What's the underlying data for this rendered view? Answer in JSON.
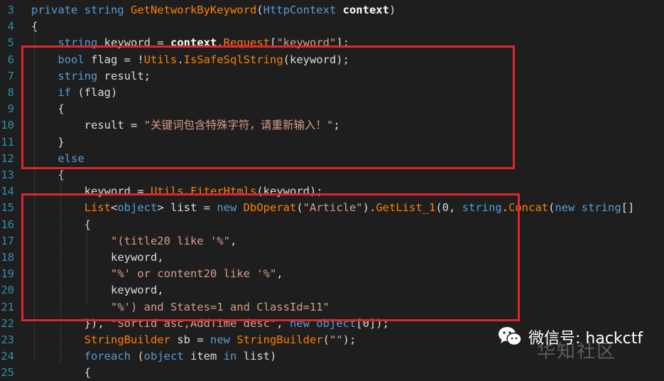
{
  "editor": {
    "lines": [
      {
        "n": "3",
        "tokens": [
          [
            "kw",
            "private string "
          ],
          [
            "m",
            "GetNetworkByKeyword"
          ],
          [
            "x",
            "("
          ],
          [
            "kw",
            "HttpContext "
          ],
          [
            "b",
            "context"
          ],
          [
            "x",
            ")"
          ]
        ]
      },
      {
        "n": "4",
        "tokens": [
          [
            "x",
            "{"
          ]
        ]
      },
      {
        "n": "5",
        "tokens": [
          [
            "x",
            "    "
          ],
          [
            "kw",
            "string "
          ],
          [
            "x",
            "keyword = "
          ],
          [
            "b",
            "context"
          ],
          [
            "x",
            "."
          ],
          [
            "m",
            "Request"
          ],
          [
            "x",
            "["
          ],
          [
            "s",
            "\"keyword\""
          ],
          [
            "x",
            "];"
          ]
        ]
      },
      {
        "n": "6",
        "tokens": [
          [
            "x",
            "    "
          ],
          [
            "kw",
            "bool "
          ],
          [
            "x",
            "flag = !"
          ],
          [
            "m",
            "Utils"
          ],
          [
            "x",
            "."
          ],
          [
            "m",
            "IsSafeSqlString"
          ],
          [
            "x",
            "(keyword);"
          ]
        ]
      },
      {
        "n": "7",
        "tokens": [
          [
            "x",
            "    "
          ],
          [
            "kw",
            "string "
          ],
          [
            "x",
            "result;"
          ]
        ]
      },
      {
        "n": "8",
        "tokens": [
          [
            "x",
            "    "
          ],
          [
            "kw",
            "if "
          ],
          [
            "x",
            "(flag)"
          ]
        ]
      },
      {
        "n": "9",
        "tokens": [
          [
            "x",
            "    {"
          ]
        ]
      },
      {
        "n": "10",
        "tokens": [
          [
            "x",
            "        result = "
          ],
          [
            "s",
            "\"关键词包含特殊字符，请重新输入！\""
          ],
          [
            "x",
            ";"
          ]
        ]
      },
      {
        "n": "11",
        "tokens": [
          [
            "x",
            "    }"
          ]
        ]
      },
      {
        "n": "12",
        "tokens": [
          [
            "x",
            "    "
          ],
          [
            "kw",
            "else"
          ]
        ]
      },
      {
        "n": "13",
        "tokens": [
          [
            "x",
            "    {"
          ]
        ]
      },
      {
        "n": "14",
        "tokens": [
          [
            "x",
            "        keyword = "
          ],
          [
            "m",
            "Utils"
          ],
          [
            "x",
            "."
          ],
          [
            "m",
            "FiterHtmls"
          ],
          [
            "x",
            "(keyword);"
          ]
        ]
      },
      {
        "n": "15",
        "tokens": [
          [
            "x",
            "        "
          ],
          [
            "m",
            "List"
          ],
          [
            "x",
            "<"
          ],
          [
            "kw",
            "object"
          ],
          [
            "x",
            "> list = "
          ],
          [
            "kw",
            "new "
          ],
          [
            "m",
            "DbOperat"
          ],
          [
            "x",
            "("
          ],
          [
            "s",
            "\"Article\""
          ],
          [
            "x",
            ")."
          ],
          [
            "m",
            "GetList_1"
          ],
          [
            "x",
            "(0, "
          ],
          [
            "kw",
            "string"
          ],
          [
            "x",
            "."
          ],
          [
            "m",
            "Concat"
          ],
          [
            "x",
            "("
          ],
          [
            "kw",
            "new string"
          ],
          [
            "x",
            "[]"
          ]
        ]
      },
      {
        "n": "16",
        "tokens": [
          [
            "x",
            "        {"
          ]
        ]
      },
      {
        "n": "17",
        "tokens": [
          [
            "x",
            "            "
          ],
          [
            "s",
            "\"(title20 like '%\""
          ],
          [
            "x",
            ","
          ]
        ]
      },
      {
        "n": "18",
        "tokens": [
          [
            "x",
            "            keyword,"
          ]
        ]
      },
      {
        "n": "19",
        "tokens": [
          [
            "x",
            "            "
          ],
          [
            "s",
            "\"%' or content20 like '%\""
          ],
          [
            "x",
            ","
          ]
        ]
      },
      {
        "n": "20",
        "tokens": [
          [
            "x",
            "            keyword,"
          ]
        ]
      },
      {
        "n": "21",
        "tokens": [
          [
            "x",
            "            "
          ],
          [
            "s",
            "\"%') and States=1 and ClassId=11\""
          ]
        ]
      },
      {
        "n": "22",
        "tokens": [
          [
            "x",
            "        }), "
          ],
          [
            "s",
            "\"SortId asc,AddTime desc\""
          ],
          [
            "x",
            ", "
          ],
          [
            "kw",
            "new object"
          ],
          [
            "x",
            "[0]);"
          ]
        ]
      },
      {
        "n": "23",
        "tokens": [
          [
            "x",
            "        "
          ],
          [
            "m",
            "StringBuilder "
          ],
          [
            "x",
            "sb = "
          ],
          [
            "kw",
            "new "
          ],
          [
            "m",
            "StringBuilder"
          ],
          [
            "x",
            "("
          ],
          [
            "s",
            "\"\""
          ],
          [
            "x",
            ");"
          ]
        ]
      },
      {
        "n": "24",
        "tokens": [
          [
            "x",
            "        "
          ],
          [
            "kw",
            "foreach "
          ],
          [
            "x",
            "("
          ],
          [
            "kw",
            "object "
          ],
          [
            "x",
            "item "
          ],
          [
            "kw",
            "in "
          ],
          [
            "x",
            "list)"
          ]
        ]
      },
      {
        "n": "25",
        "tokens": [
          [
            "x",
            "        {"
          ]
        ]
      }
    ]
  },
  "highlight_color": "#e0262c",
  "watermark": {
    "icon": "wechat-icon",
    "text": "微信号: hackctf",
    "ghost": "华知社区"
  }
}
